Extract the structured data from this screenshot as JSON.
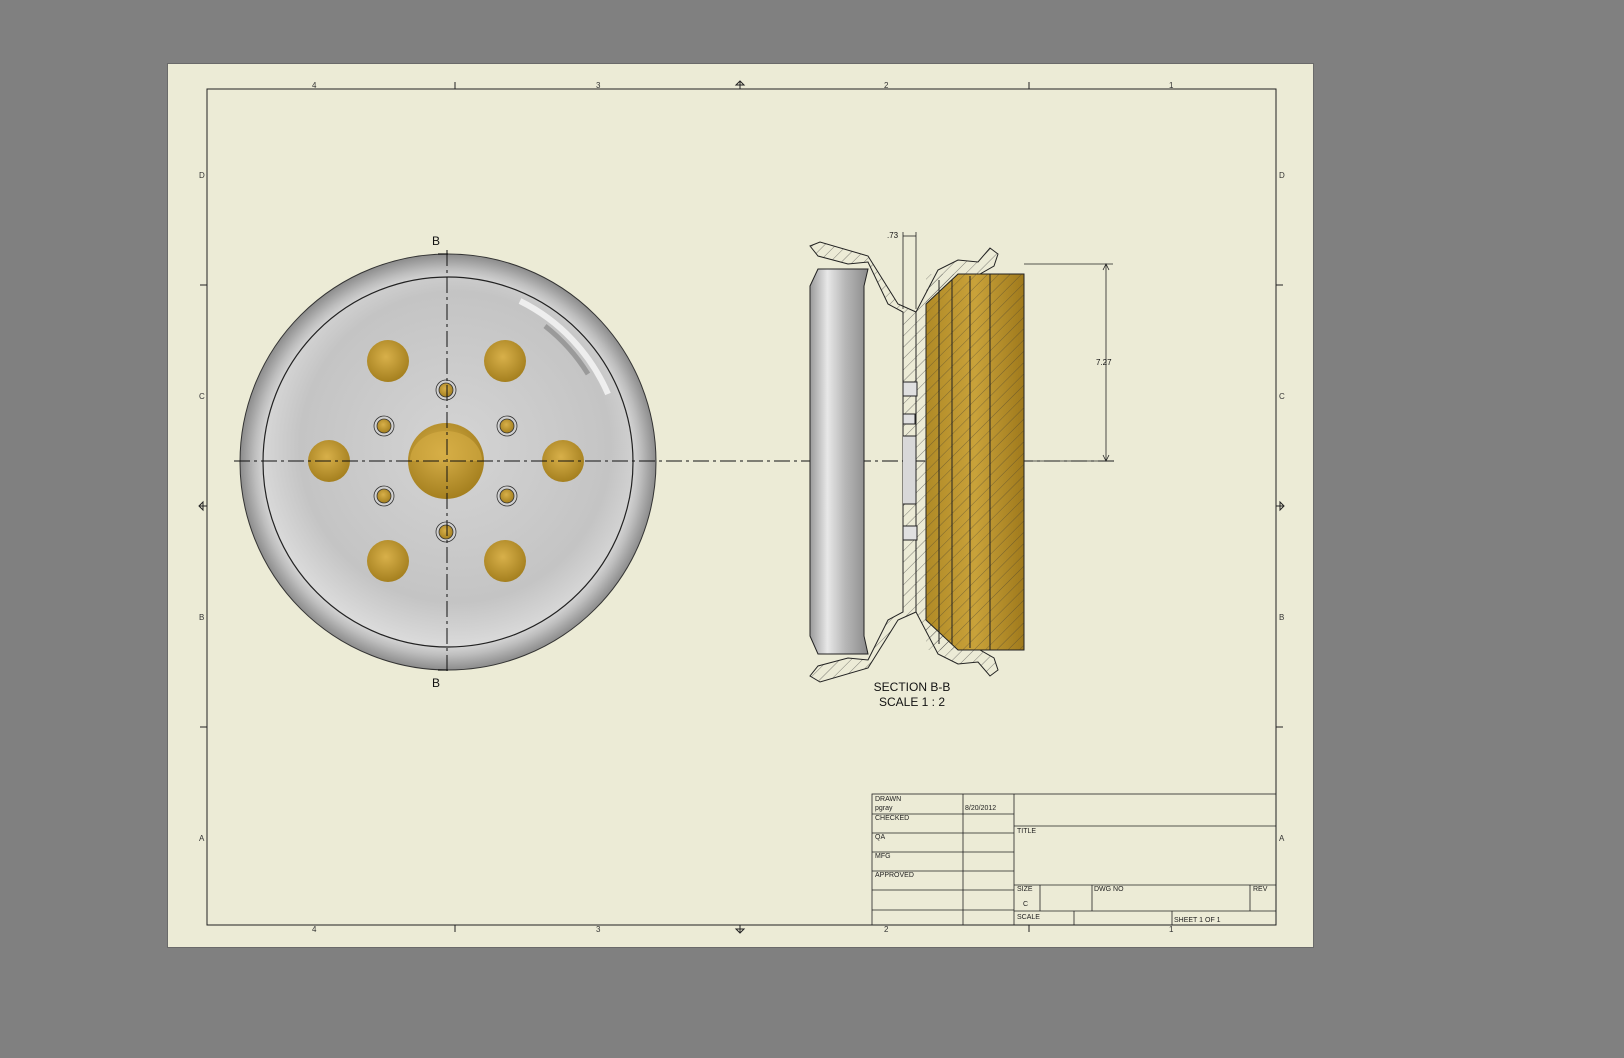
{
  "sheet": {
    "zones_top": [
      "4",
      "3",
      "2",
      "1"
    ],
    "zones_side": [
      "D",
      "C",
      "B",
      "A"
    ]
  },
  "front_view": {
    "section_cut_label": "B"
  },
  "section_view": {
    "title": "SECTION B-B",
    "scale": "SCALE 1 : 2",
    "dim_flange": ".73",
    "dim_radius": "7.27"
  },
  "title_block": {
    "drawn_label": "DRAWN",
    "drawn_by": "pgray",
    "drawn_date": "8/20/2012",
    "checked_label": "CHECKED",
    "qa_label": "QA",
    "mfg_label": "MFG",
    "approved_label": "APPROVED",
    "title_label": "TITLE",
    "size_label": "SIZE",
    "size_value": "C",
    "dwg_no_label": "DWG NO",
    "rev_label": "REV",
    "scale_label": "SCALE",
    "sheet_label": "SHEET 1  OF 1"
  },
  "colors": {
    "workspace": "#808080",
    "paper": "#ecebd6",
    "metal": "#c8c8c8",
    "hole_gold": "#c29a2e",
    "section_gold": "#b8902c"
  }
}
